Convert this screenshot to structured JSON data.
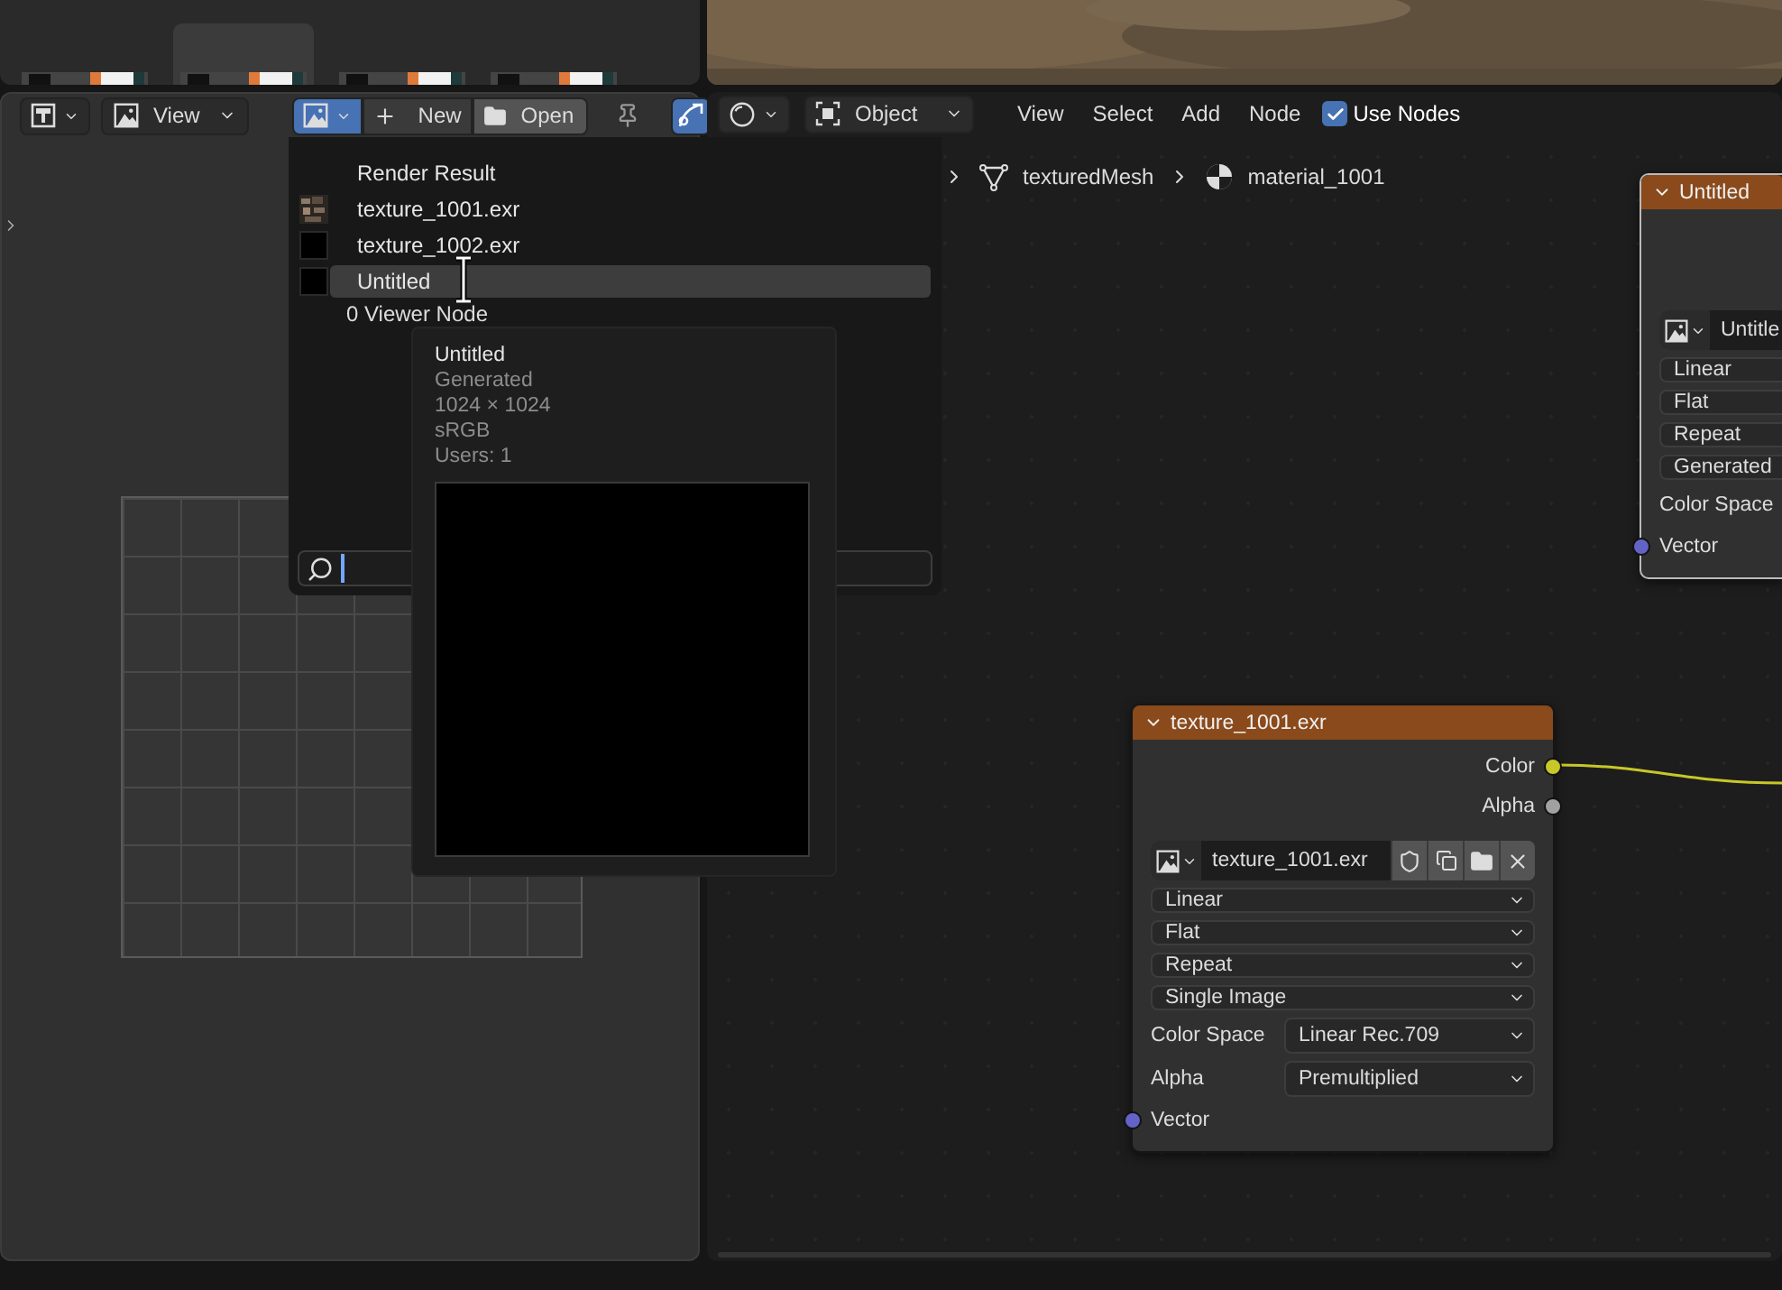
{
  "file_browser": {
    "thumbnails": [
      {
        "selected": false
      },
      {
        "selected": true
      },
      {
        "selected": false
      },
      {
        "selected": false
      }
    ]
  },
  "image_editor": {
    "view_menu": "View",
    "new_label": "New",
    "open_label": "Open",
    "gizmo_on": true
  },
  "image_menu": {
    "items": [
      {
        "label": "Render Result",
        "kind": "none",
        "selected": false
      },
      {
        "label": "texture_1001.exr",
        "kind": "noise",
        "selected": false
      },
      {
        "label": "texture_1002.exr",
        "kind": "black",
        "selected": false
      },
      {
        "label": "Untitled",
        "kind": "black",
        "selected": true
      }
    ],
    "footer": "0 Viewer Node"
  },
  "tooltip": {
    "title": "Untitled",
    "lines": [
      "Generated",
      "1024 × 1024",
      "sRGB",
      "Users: 1"
    ]
  },
  "node_editor": {
    "mode": "Object",
    "menus": [
      "View",
      "Select",
      "Add",
      "Node"
    ],
    "use_nodes": {
      "label": "Use Nodes",
      "checked": true
    },
    "breadcrumb": [
      "texturedMesh",
      "material_1001"
    ]
  },
  "nodes": [
    {
      "title": "Untitled",
      "clipped": true,
      "image": "Untitle",
      "image_actions": false,
      "dropdowns": [
        "Linear",
        "Flat",
        "Repeat",
        "Generated"
      ],
      "properties": [
        {
          "label": "Color Space"
        }
      ],
      "inputs": [
        {
          "label": "Vector",
          "color": "#6363c7"
        }
      ]
    },
    {
      "title": "texture_1001.exr",
      "clipped": false,
      "outputs": [
        {
          "label": "Color",
          "color": "#c7c729"
        },
        {
          "label": "Alpha",
          "color": "#a1a1a1"
        }
      ],
      "image": "texture_1001.exr",
      "image_actions": true,
      "dropdowns": [
        "Linear",
        "Flat",
        "Repeat",
        "Single Image"
      ],
      "properties": [
        {
          "label": "Color Space",
          "value": "Linear Rec.709"
        },
        {
          "label": "Alpha",
          "value": "Premultiplied"
        }
      ],
      "inputs": [
        {
          "label": "Vector",
          "color": "#6363c7"
        }
      ]
    }
  ]
}
